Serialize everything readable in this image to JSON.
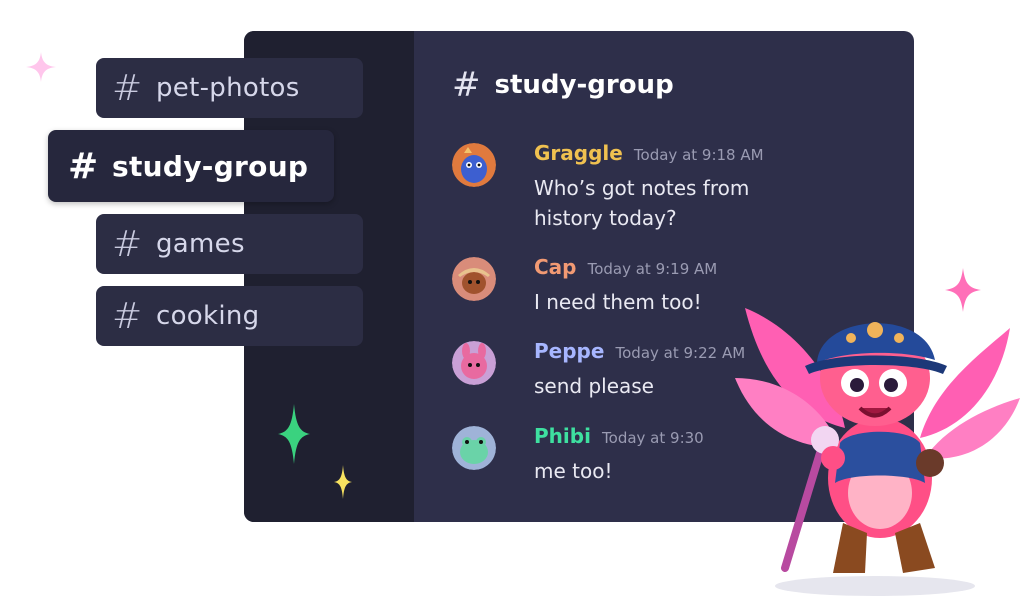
{
  "sidebar": {
    "channels": [
      {
        "hash": "#",
        "name": "pet-photos"
      },
      {
        "hash": "#",
        "name": "study-group"
      },
      {
        "hash": "#",
        "name": "games"
      },
      {
        "hash": "#",
        "name": "cooking"
      }
    ]
  },
  "chat": {
    "header": {
      "hash": "#",
      "title": "study-group"
    },
    "messages": [
      {
        "author": "Graggle",
        "time": "Today at 9:18 AM",
        "text": "Who’s got notes from history today?",
        "color": "#f0c150"
      },
      {
        "author": "Cap",
        "time": "Today at 9:19 AM",
        "text": "I need them too!",
        "color": "#f29a73"
      },
      {
        "author": "Peppe",
        "time": "Today at 9:22 AM",
        "text": "send please",
        "color": "#a7b6ff"
      },
      {
        "author": "Phibi",
        "time": "Today at 9:30",
        "text": "me too!",
        "color": "#3ee0a0"
      }
    ]
  },
  "colors": {
    "panel_bg": "#2e2f4a",
    "sidebar_bg": "#1f2030",
    "channel_bg": "#2c2d44",
    "sparkle_green": "#3ad27f",
    "sparkle_yellow": "#f7e260",
    "sparkle_pink": "#ffc6ec",
    "mascot_pink": "#ff5fb3"
  },
  "decor": {
    "icons": [
      "sparkle-pink-icon",
      "sparkle-green-icon",
      "sparkle-yellow-icon",
      "mascot-illustration"
    ]
  }
}
